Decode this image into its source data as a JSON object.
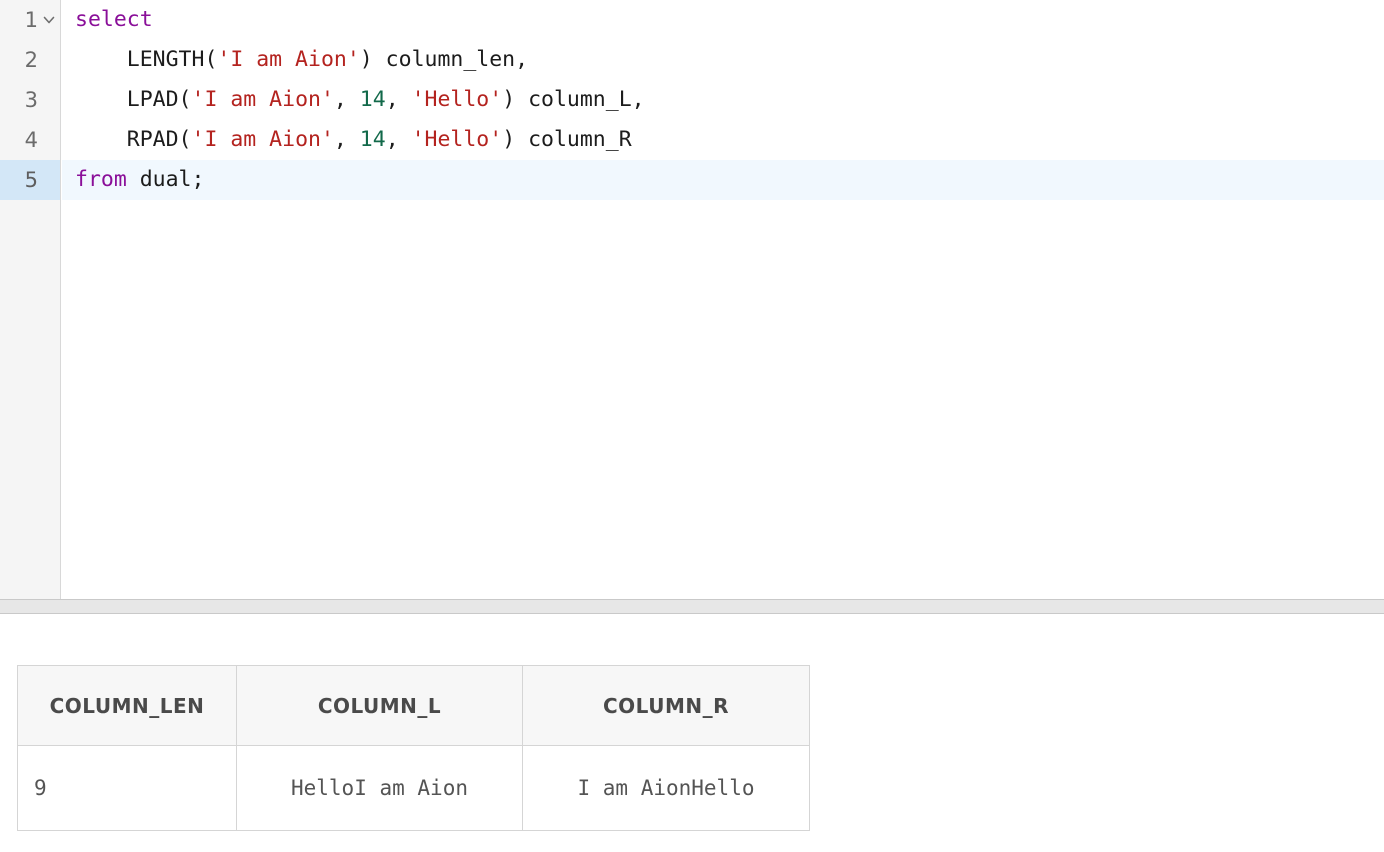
{
  "editor": {
    "language": "sql",
    "lines": [
      {
        "number": "1",
        "folded": false,
        "has_fold_toggle": true,
        "active": false,
        "text": "select",
        "tokens": [
          {
            "t": "kw",
            "v": "select"
          }
        ]
      },
      {
        "number": "2",
        "has_fold_toggle": false,
        "active": false,
        "text": "    LENGTH('I am Aion') column_len,",
        "tokens": [
          {
            "t": "pun",
            "v": "    "
          },
          {
            "t": "fn",
            "v": "LENGTH("
          },
          {
            "t": "str",
            "v": "'I am Aion'"
          },
          {
            "t": "pun",
            "v": ")"
          },
          {
            "t": "id",
            "v": " column_len,"
          }
        ]
      },
      {
        "number": "3",
        "has_fold_toggle": false,
        "active": false,
        "text": "    LPAD('I am Aion', 14, 'Hello') column_L,",
        "tokens": [
          {
            "t": "pun",
            "v": "    "
          },
          {
            "t": "fn",
            "v": "LPAD("
          },
          {
            "t": "str",
            "v": "'I am Aion'"
          },
          {
            "t": "pun",
            "v": ", "
          },
          {
            "t": "num",
            "v": "14"
          },
          {
            "t": "pun",
            "v": ", "
          },
          {
            "t": "str",
            "v": "'Hello'"
          },
          {
            "t": "pun",
            "v": ")"
          },
          {
            "t": "id",
            "v": " column_L,"
          }
        ]
      },
      {
        "number": "4",
        "has_fold_toggle": false,
        "active": false,
        "text": "    RPAD('I am Aion', 14, 'Hello') column_R",
        "tokens": [
          {
            "t": "pun",
            "v": "    "
          },
          {
            "t": "fn",
            "v": "RPAD("
          },
          {
            "t": "str",
            "v": "'I am Aion'"
          },
          {
            "t": "pun",
            "v": ", "
          },
          {
            "t": "num",
            "v": "14"
          },
          {
            "t": "pun",
            "v": ", "
          },
          {
            "t": "str",
            "v": "'Hello'"
          },
          {
            "t": "pun",
            "v": ")"
          },
          {
            "t": "id",
            "v": " column_R"
          }
        ]
      },
      {
        "number": "5",
        "has_fold_toggle": false,
        "active": true,
        "text": "from dual;",
        "tokens": [
          {
            "t": "kw",
            "v": "from"
          },
          {
            "t": "id",
            "v": " dual;"
          }
        ]
      }
    ],
    "colors": {
      "keyword": "#8a0f99",
      "string": "#b4231f",
      "number": "#12694a",
      "plain": "#1c1c1c",
      "gutter_background": "#f5f5f5",
      "gutter_number": "#6b6b6b",
      "active_line_background": "#f1f8fe",
      "active_gutter_background": "#d3e7f7"
    },
    "fold_icon": "chevron-down-icon"
  },
  "splitter": {
    "orientation": "horizontal",
    "color": "#e7e7e7"
  },
  "results": {
    "columns": [
      {
        "label": "COLUMN_LEN",
        "align": "left"
      },
      {
        "label": "COLUMN_L",
        "align": "center"
      },
      {
        "label": "COLUMN_R",
        "align": "center"
      }
    ],
    "rows": [
      [
        {
          "value": "9",
          "align": "left"
        },
        {
          "value": "HelloI am Aion",
          "align": "center"
        },
        {
          "value": "I am AionHello",
          "align": "center"
        }
      ]
    ],
    "colors": {
      "header_background": "#f7f7f7",
      "header_text": "#4a4a4a",
      "cell_text": "#545454",
      "border": "#d5d5d5"
    }
  }
}
